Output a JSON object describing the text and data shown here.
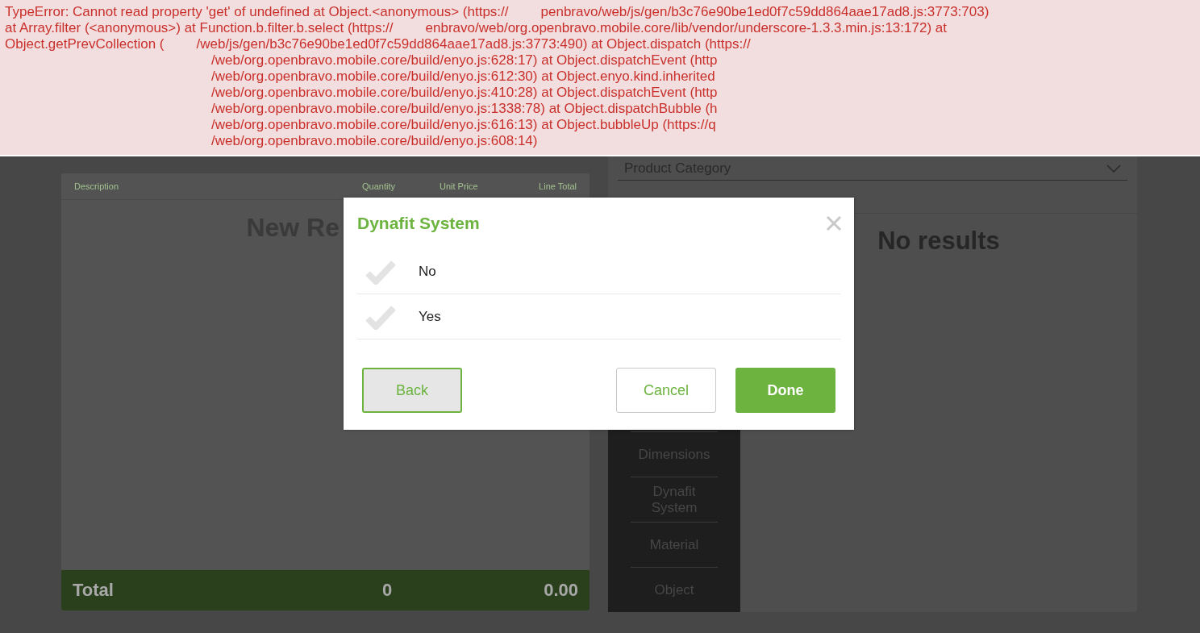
{
  "error_banner": {
    "lines": [
      {
        "indented": false,
        "segments": [
          "TypeError: Cannot read property 'get' of undefined at Object.<anonymous> (https://",
          "penbravo/web/js/gen/b3c76e90be1ed0f7c59dd864aae17ad8.js:3773:703)"
        ]
      },
      {
        "indented": false,
        "segments": [
          "at Array.filter (<anonymous>) at Function.b.filter.b.select (https://",
          "enbravo/web/org.openbravo.mobile.core/lib/vendor/underscore-1.3.3.min.js:13:172) at"
        ]
      },
      {
        "indented": false,
        "segments": [
          "Object.getPrevCollection (",
          "/web/js/gen/b3c76e90be1ed0f7c59dd864aae17ad8.js:3773:490) at Object.dispatch (https://"
        ]
      },
      {
        "indented": true,
        "segments": [
          "/web/org.openbravo.mobile.core/build/enyo.js:628:17) at Object.dispatchEvent (http"
        ]
      },
      {
        "indented": true,
        "segments": [
          "/web/org.openbravo.mobile.core/build/enyo.js:612:30) at Object.enyo.kind.inherited"
        ]
      },
      {
        "indented": true,
        "segments": [
          "/web/org.openbravo.mobile.core/build/enyo.js:410:28) at Object.dispatchEvent (http"
        ]
      },
      {
        "indented": true,
        "segments": [
          "/web/org.openbravo.mobile.core/build/enyo.js:1338:78) at Object.dispatchBubble (h"
        ]
      },
      {
        "indented": true,
        "segments": [
          "/web/org.openbravo.mobile.core/build/enyo.js:616:13) at Object.bubbleUp (https://q"
        ]
      },
      {
        "indented": true,
        "segments": [
          "/web/org.openbravo.mobile.core/build/enyo.js:608:14)"
        ]
      }
    ]
  },
  "receipt": {
    "columns": [
      "Description",
      "Quantity",
      "Unit Price",
      "Line Total"
    ],
    "title": "New Re",
    "total": {
      "label": "Total",
      "quantity": "0",
      "amount": "0.00"
    }
  },
  "catalog": {
    "category": {
      "placeholder": "Product Category"
    },
    "message": "No results",
    "sidebar": [
      {
        "label": "Dimensions"
      },
      {
        "label": "Dynafit System"
      },
      {
        "label": "Material"
      },
      {
        "label": "Object"
      }
    ]
  },
  "dialog": {
    "title": "Dynafit System",
    "options": [
      {
        "label": "No",
        "selected": false
      },
      {
        "label": "Yes",
        "selected": false
      }
    ],
    "buttons": [
      {
        "label": "Back",
        "kind": "back"
      },
      {
        "label": "Cancel",
        "kind": "secondary"
      },
      {
        "label": "Done",
        "kind": "primary"
      }
    ]
  }
}
